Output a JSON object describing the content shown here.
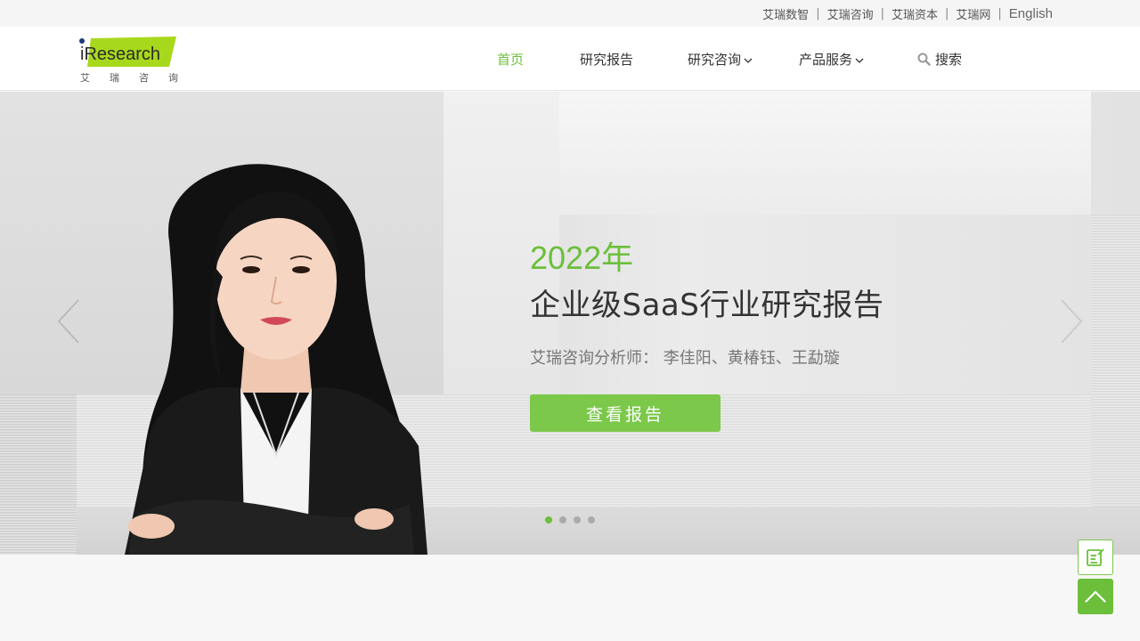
{
  "topbar": {
    "links": [
      {
        "label": "艾瑞数智"
      },
      {
        "label": "艾瑞咨询"
      },
      {
        "label": "艾瑞资本"
      },
      {
        "label": "艾瑞网"
      },
      {
        "label": "English"
      }
    ],
    "separator": "|"
  },
  "logo": {
    "wordmark": "iResearch",
    "subtitle_chars": [
      "艾",
      "瑞",
      "咨",
      "询"
    ]
  },
  "nav": {
    "items": [
      {
        "label": "首页",
        "active": true
      },
      {
        "label": "研究报告"
      },
      {
        "label": "研究咨询",
        "icon": "chevron-down-icon"
      },
      {
        "label": "产品服务",
        "icon": "chevron-down-icon"
      }
    ],
    "search_label": "搜索",
    "search_icon": "search-icon"
  },
  "banner": {
    "year": "2022年",
    "title": "企业级SaaS行业研究报告",
    "authors": "艾瑞咨询分析师： 李佳阳、黄椿钰、王勐璇",
    "button_label": "查看报告",
    "slides_total": 4,
    "slide_active": 1
  },
  "floating": {
    "feedback_icon": "edit-note-icon",
    "top_icon": "chevron-up-icon"
  },
  "colors": {
    "accent": "#6cbf3b",
    "button": "#7bc84a",
    "logo_green": "#a8d81c"
  }
}
